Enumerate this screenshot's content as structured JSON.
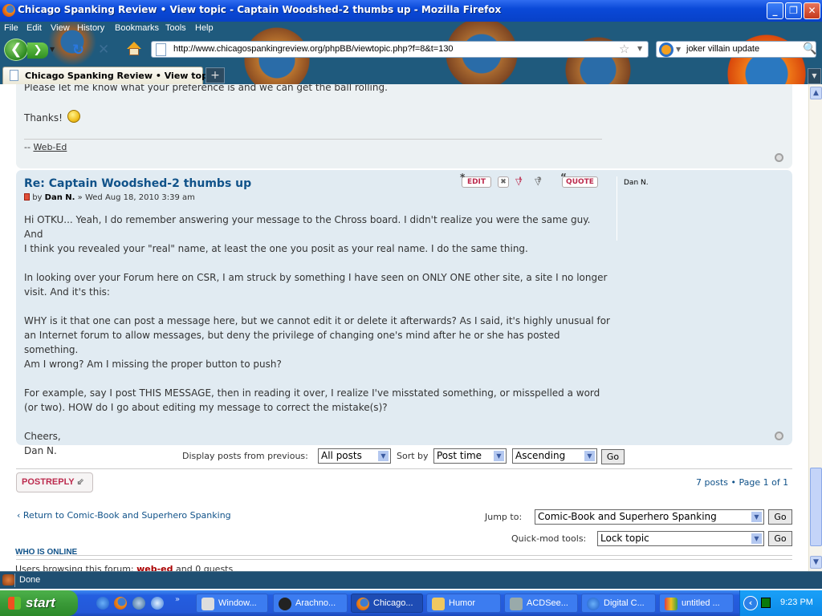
{
  "window": {
    "title": "Chicago Spanking Review • View topic - Captain Woodshed-2 thumbs up - Mozilla Firefox",
    "controls": {
      "minimize": "_",
      "maximize": "❐",
      "close": "✕"
    }
  },
  "menu": [
    "File",
    "Edit",
    "View",
    "History",
    "Bookmarks",
    "Tools",
    "Help"
  ],
  "navigation": {
    "back": "❮",
    "forward": "❯",
    "reload": "↻",
    "stop": "✕",
    "url": "http://www.chicagospankingreview.org/phpBB/viewtopic.php?f=8&t=130",
    "search_query": "joker villain update"
  },
  "tabs": [
    {
      "label": "Chicago Spanking Review • View topi...",
      "active": true
    }
  ],
  "new_tab": "+",
  "previous_post": {
    "cut_line": "Please let me know what your preference is and we can get the ball rolling.",
    "thanks": "Thanks!",
    "signature_prefix": "--",
    "signature_name": "Web-Ed"
  },
  "post": {
    "title": "Re: Captain Woodshed-2 thumbs up",
    "by_label": "by",
    "author": "Dan N.",
    "separator": "»",
    "date": "Wed Aug 18, 2010 3:39 am",
    "buttons": {
      "edit": "EDIT",
      "delete": "✖",
      "report": "!",
      "info": "?",
      "quote": "QUOTE"
    },
    "profile_name": "Dan N.",
    "body": [
      "Hi OTKU... Yeah, I do remember answering your message to the Chross board. I didn't realize you were the same guy. And",
      "I think you revealed your \"real\" name, at least the one you posit as your real name. I do the same thing.",
      "",
      "In looking over your Forum here on CSR, I am struck by something I have seen on ONLY ONE other site, a site I no longer",
      "visit. And it's this:",
      "",
      "WHY is it that one can post a message here, but we cannot edit it or delete it afterwards? As I said, it's highly unusual for",
      "an Internet forum to allow messages, but deny the privilege of changing one's mind after he or she has posted something.",
      "Am I wrong? Am I missing the proper button to push?",
      "",
      "For example, say I post THIS MESSAGE, then in reading it over, I realize I've misstated something, or misspelled a word",
      "(or two). HOW do I go about editing my message to correct the mistake(s)?",
      "",
      "Cheers,",
      "Dan N."
    ]
  },
  "sort": {
    "display_label": "Display posts from previous:",
    "display_value": "All posts",
    "sort_label": "Sort by",
    "sort_value": "Post time",
    "order_value": "Ascending",
    "go": "Go"
  },
  "footer": {
    "post_reply": "POSTREPLY",
    "pagination": "7 posts • Page 1 of 1",
    "return_link": "Return to Comic-Book and Superhero Spanking",
    "jump_label": "Jump to:",
    "jump_value": "Comic-Book and Superhero Spanking",
    "quickmod_label": "Quick-mod tools:",
    "quickmod_value": "Lock topic",
    "go": "Go",
    "who_is_online": "WHO IS ONLINE",
    "users_browsing_prefix": "Users browsing this forum:",
    "users_browsing_user": "web-ed",
    "users_browsing_suffix": "and 0 guests"
  },
  "status": {
    "text": "Done"
  },
  "taskbar": {
    "start": "start",
    "tasks": [
      {
        "label": "Window...",
        "active": false
      },
      {
        "label": "Arachno...",
        "active": false
      },
      {
        "label": "Chicago...",
        "active": true
      },
      {
        "label": "Humor",
        "active": false
      },
      {
        "label": "ACDSee...",
        "active": false
      },
      {
        "label": "Digital C...",
        "active": false
      },
      {
        "label": "untitled ...",
        "active": false
      }
    ],
    "clock": "9:23 PM"
  },
  "colors": {
    "link": "#105289",
    "button_red": "#bc2a4d",
    "post_bg1": "#ecf1f3",
    "post_bg2": "#e1ebf2"
  }
}
